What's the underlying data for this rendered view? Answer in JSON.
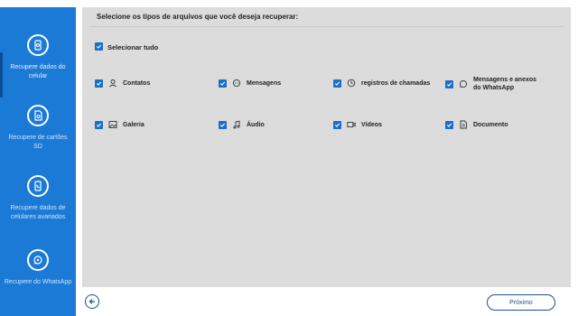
{
  "sidebar": {
    "items": [
      {
        "label": "Recupere dados do celular",
        "icon": "phone-recovery-icon"
      },
      {
        "label": "Recupere de cartões SD",
        "icon": "sd-card-icon"
      },
      {
        "label": "Recupere dados de celulares avariados",
        "icon": "broken-phone-icon"
      },
      {
        "label": "Recupere do WhatsApp",
        "icon": "whatsapp-icon"
      }
    ]
  },
  "main": {
    "heading": "Selecione os tipos de arquivos que você deseja recuperar:",
    "select_all_label": "Selecionar tudo",
    "options": [
      {
        "label": "Contatos",
        "icon": "person-icon",
        "checked": true
      },
      {
        "label": "Mensagens",
        "icon": "message-icon",
        "checked": true
      },
      {
        "label": "registros de chamadas",
        "icon": "clock-icon",
        "checked": true
      },
      {
        "label": "Mensagens e anexos do WhatsApp",
        "icon": "whatsapp-icon",
        "checked": true
      },
      {
        "label": "Galeria",
        "icon": "image-icon",
        "checked": true
      },
      {
        "label": "Áudio",
        "icon": "music-note-icon",
        "checked": true
      },
      {
        "label": "Vídeos",
        "icon": "video-icon",
        "checked": true
      },
      {
        "label": "Documento",
        "icon": "document-icon",
        "checked": true
      }
    ]
  },
  "footer": {
    "next_label": "Próximo"
  },
  "colors": {
    "sidebar": "#1c7ad7",
    "checkbox": "#1b6fc4",
    "content_bg": "#dcdcdc",
    "button_border": "#1c4f8a"
  }
}
